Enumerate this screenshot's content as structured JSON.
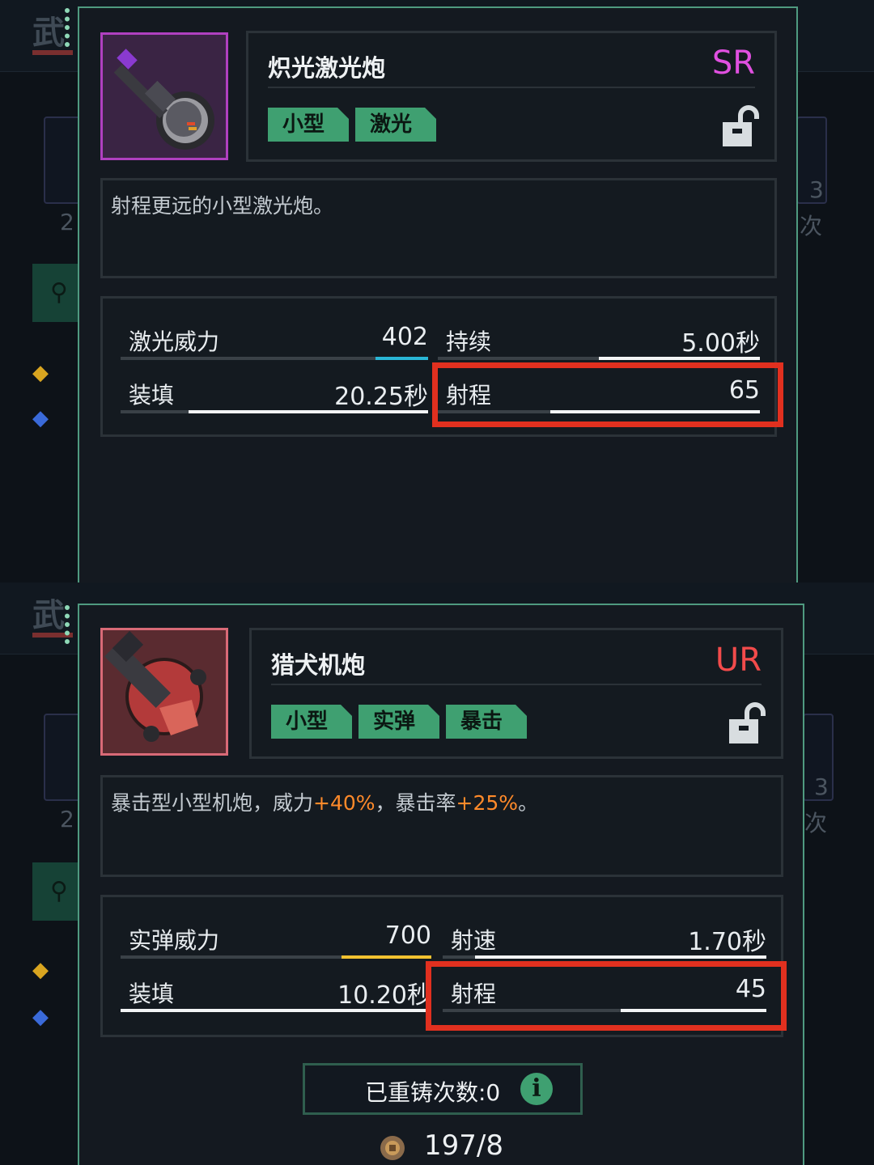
{
  "background": {
    "page_title": "武",
    "side_counts": [
      "2",
      "3",
      "次"
    ]
  },
  "panels": [
    {
      "weapon_name": "炽光激光炮",
      "rarity": "SR",
      "rarity_color": "#e050e0",
      "tags": [
        "小型",
        "激光"
      ],
      "description": "射程更远的小型激光炮。",
      "stats": [
        {
          "label": "激光威力",
          "value": "402",
          "fill": 0.17,
          "accent": "#29b6d6"
        },
        {
          "label": "持续",
          "value": "5.00秒",
          "fill": 0.5,
          "accent": "#f2f4f5"
        },
        {
          "label": "装填",
          "value": "20.25秒",
          "fill": 0.78,
          "accent": "#f2f4f5"
        },
        {
          "label": "射程",
          "value": "65",
          "fill": 0.65,
          "accent": "#f2f4f5",
          "highlighted": true
        }
      ]
    },
    {
      "weapon_name": "猎犬机炮",
      "rarity": "UR",
      "rarity_color": "#f24b4b",
      "tags": [
        "小型",
        "实弹",
        "暴击"
      ],
      "description": {
        "part1": "暴击型小型机炮，威力",
        "bonus1": "+40%",
        "part2": "，暴击率",
        "bonus2": "+25%",
        "part3": "。"
      },
      "stats": [
        {
          "label": "实弹威力",
          "value": "700",
          "fill": 0.29,
          "accent": "#f2c230"
        },
        {
          "label": "射速",
          "value": "1.70秒",
          "fill": 0.9,
          "accent": "#f2f4f5"
        },
        {
          "label": "装填",
          "value": "10.20秒",
          "fill": 1.0,
          "accent": "#f2f4f5"
        },
        {
          "label": "射程",
          "value": "45",
          "fill": 0.45,
          "accent": "#f2f4f5",
          "highlighted": true
        }
      ],
      "reforge": {
        "label": "已重铸次数:0",
        "info_icon": "info-icon"
      },
      "cost": {
        "value": "197/8",
        "icon": "gear-coin-icon"
      }
    }
  ]
}
